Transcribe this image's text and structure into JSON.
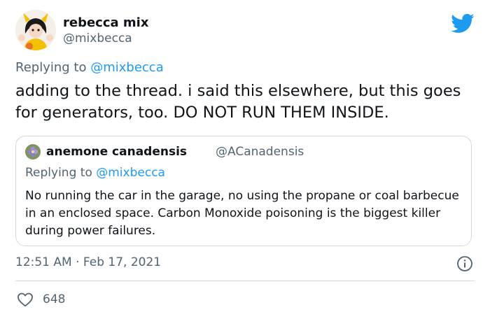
{
  "tweet": {
    "author": {
      "name": "rebecca mix",
      "handle": "@mixbecca"
    },
    "reply": {
      "prefix": "Replying to",
      "to": "@mixbecca"
    },
    "text": "adding to the thread. i said this elsewhere, but this goes for generators, too. DO NOT RUN THEM INSIDE.",
    "quote": {
      "author": {
        "name": "anemone canadensis",
        "handle": "@ACanadensis"
      },
      "reply": {
        "prefix": "Replying to",
        "to": "@mixbecca"
      },
      "text": "No running the car in the garage, no using the propane or coal barbecue in an enclosed space. Carbon Monoxide poisoning is the biggest killer during power failures."
    },
    "time": "12:51 AM",
    "separator": "·",
    "date": "Feb 17, 2021",
    "likes": "648"
  },
  "icons": {
    "brand": "twitter-bird-icon",
    "info": "info-icon",
    "like": "heart-icon"
  },
  "colors": {
    "brand_blue": "#1d9bf0",
    "text": "#0f1419",
    "secondary": "#536471",
    "border": "#cfd9de"
  }
}
